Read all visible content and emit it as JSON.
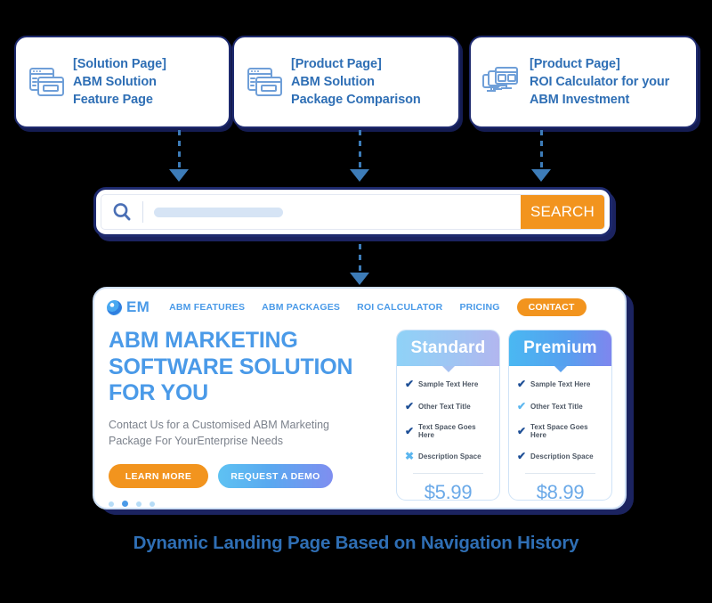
{
  "cards": [
    {
      "icon": "browser-windows-icon",
      "line1": "[Solution Page]",
      "line2": "ABM Solution",
      "line3": "Feature Page"
    },
    {
      "icon": "browser-windows-icon",
      "line1": "[Product Page]",
      "line2": "ABM Solution",
      "line3": "Package Comparison"
    },
    {
      "icon": "desktop-monitors-icon",
      "line1": "[Product Page]",
      "line2": "ROI Calculator for your",
      "line3": "ABM Investment"
    }
  ],
  "search": {
    "icon": "search-magnifier-icon",
    "value": "",
    "placeholder": "",
    "button_label": "SEARCH",
    "button_color": "#f2941e"
  },
  "landing": {
    "logo_text": "EM",
    "logo_icon": "em-circle-logo-icon",
    "nav": [
      {
        "label": "ABM FEATURES",
        "active": false
      },
      {
        "label": "ABM PACKAGES",
        "active": false
      },
      {
        "label": "ROI CALCULATOR",
        "active": false
      },
      {
        "label": "PRICING",
        "active": false
      },
      {
        "label": "CONTACT",
        "active": true
      }
    ],
    "hero": {
      "title_line1": "ABM MARKETING",
      "title_line2": "SOFTWARE SOLUTION",
      "title_line3": "FOR YOU",
      "subtitle_line1": "Contact Us  for a Customised ABM Marketing",
      "subtitle_line2": "Package For YourEnterprise Needs",
      "primary_button": "LEARN MORE",
      "secondary_button": "REQUEST A DEMO"
    },
    "carousel_dots": 4,
    "carousel_active_index": 1,
    "pricing": [
      {
        "name": "Standard",
        "price": "$5.99",
        "features": [
          {
            "mark": "check-icon",
            "label": "Sample Text Here"
          },
          {
            "mark": "check-icon",
            "label": "Other Text Title"
          },
          {
            "mark": "check-icon",
            "label": "Text Space Goes Here"
          },
          {
            "mark": "cross-icon",
            "label": "Description Space"
          }
        ]
      },
      {
        "name": "Premium",
        "price": "$8.99",
        "features": [
          {
            "mark": "check-icon",
            "label": "Sample Text Here"
          },
          {
            "mark": "check-icon",
            "label": "Other Text Title"
          },
          {
            "mark": "check-icon",
            "label": "Text Space Goes Here"
          },
          {
            "mark": "check-icon",
            "label": "Description Space"
          }
        ]
      }
    ]
  },
  "caption": "Dynamic Landing Page Based on Navigation History",
  "colors": {
    "brand_blue": "#4a9ae8",
    "deep_navy": "#1e2a6e",
    "accent_orange": "#f2941e",
    "caption_blue": "#2f6fb5",
    "connector_blue": "#3d7cb8"
  }
}
